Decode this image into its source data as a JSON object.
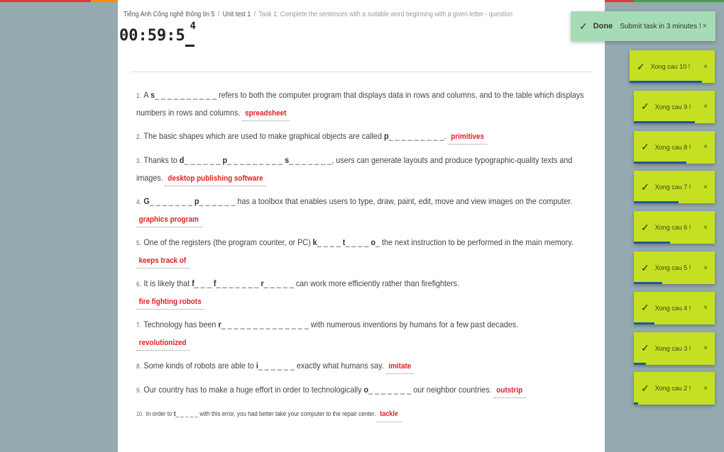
{
  "stripe_colors": [
    "#e53935",
    "#fb8c00",
    "#fdd835",
    "#43a047",
    "#1e88e5",
    "#8e24aa",
    "#e53935",
    "#43a047"
  ],
  "breadcrumb": [
    "Tiếng Anh Công nghệ thông tin 5",
    "Unit test 1",
    "Task 1: Complete the sentences with a suitable word beginning with a given letter - question"
  ],
  "timer": {
    "main": "00:59:5",
    "last": "_",
    "sup": "4"
  },
  "questions": [
    {
      "num": "1.",
      "parts": [
        {
          "t": "A "
        },
        {
          "b": "s"
        },
        {
          "t": "_ _ _ _ _ _ _ _ _ _ refers to both the computer program that displays data in rows and columns, and to the table which displays numbers in rows and columns. "
        }
      ],
      "answer": "spreadsheet"
    },
    {
      "num": "2.",
      "parts": [
        {
          "t": "The basic shapes which are used to make graphical objects are called "
        },
        {
          "b": "p"
        },
        {
          "t": "_ _ _ _ _ _ _ _ _. "
        }
      ],
      "answer": "primitives"
    },
    {
      "num": "3.",
      "parts": [
        {
          "t": "Thanks to "
        },
        {
          "b": "d"
        },
        {
          "t": "_ _ _ _ _ _ "
        },
        {
          "b": "p"
        },
        {
          "t": "_ _ _ _ _ _ _ _ _ "
        },
        {
          "b": "s"
        },
        {
          "t": "_ _ _ _ _ _ _, users can generate layouts and produce typographic-quality texts and images. "
        }
      ],
      "answer": "desktop publishing software"
    },
    {
      "num": "4.",
      "parts": [
        {
          "b": "G"
        },
        {
          "t": "_ _ _ _ _ _ _ "
        },
        {
          "b": "p"
        },
        {
          "t": "_ _ _ _ _ _ has a toolbox that enables users to type, draw, paint, edit, move and view images on the computer. "
        }
      ],
      "answer": "graphics program",
      "break": true
    },
    {
      "num": "5.",
      "parts": [
        {
          "t": "One of the registers (the program counter, or PC) "
        },
        {
          "b": "k"
        },
        {
          "t": "_ _ _ _ "
        },
        {
          "b": "t"
        },
        {
          "t": "_ _ _ _ "
        },
        {
          "b": "o"
        },
        {
          "t": "_ the next instruction to be performed in the main memory. "
        }
      ],
      "answer": "keeps track of",
      "break": true
    },
    {
      "num": "6.",
      "parts": [
        {
          "t": "It is likely that "
        },
        {
          "b": "f"
        },
        {
          "t": "_ _ _ "
        },
        {
          "b": "f"
        },
        {
          "t": "_ _ _ _ _ _ _ "
        },
        {
          "b": "r"
        },
        {
          "t": "_ _ _ _ _ can work more efficiently rather than firefighters. "
        }
      ],
      "answer": "fire fighting robots",
      "break": true
    },
    {
      "num": "7.",
      "parts": [
        {
          "t": "Technology has been "
        },
        {
          "b": "r"
        },
        {
          "t": "_ _ _ _ _ _ _ _ _ _ _ _ _ _ with numerous inventions by humans for a few past decades. "
        }
      ],
      "answer": "revolutionized",
      "break": true
    },
    {
      "num": "8.",
      "parts": [
        {
          "t": "Some kinds of robots are able to "
        },
        {
          "b": "i"
        },
        {
          "t": "_ _ _ _ _ _ exactly what humans say. "
        }
      ],
      "answer": "imitate"
    },
    {
      "num": "9.",
      "parts": [
        {
          "t": "Our country has to make a huge effort in order to technologically "
        },
        {
          "b": "o"
        },
        {
          "t": "_ _ _ _ _ _ _ our neighbor countries. "
        }
      ],
      "answer": "outstrip"
    },
    {
      "num": "10.",
      "parts": [
        {
          "t": "In order to "
        },
        {
          "b": "t"
        },
        {
          "t": "_ _ _ _ _ with this error, you had better take your computer to the repair center. "
        }
      ],
      "answer": "tackle",
      "small": true
    }
  ],
  "toast_done": {
    "title": "Done",
    "message": "Submit task in 3 minutes !",
    "close": "×",
    "check": "✓"
  },
  "toasts": [
    {
      "message": "Xong cau 10 !",
      "close": "×",
      "progress": 0.85
    },
    {
      "message": "Xong cau 9 !",
      "close": "×",
      "progress": 0.75
    },
    {
      "message": "Xong cau 8 !",
      "close": "×",
      "progress": 0.65
    },
    {
      "message": "Xong cau 7 !",
      "close": "×",
      "progress": 0.55
    },
    {
      "message": "Xong cau 6 !",
      "close": "×",
      "progress": 0.45
    },
    {
      "message": "Xong cau 5 !",
      "close": "×",
      "progress": 0.35
    },
    {
      "message": "Xong cau 4 !",
      "close": "×",
      "progress": 0.25
    },
    {
      "message": "Xong cau 3 !",
      "close": "×",
      "progress": 0.15
    },
    {
      "message": "Xong cau 2 !",
      "close": "×",
      "progress": 0.05
    }
  ]
}
